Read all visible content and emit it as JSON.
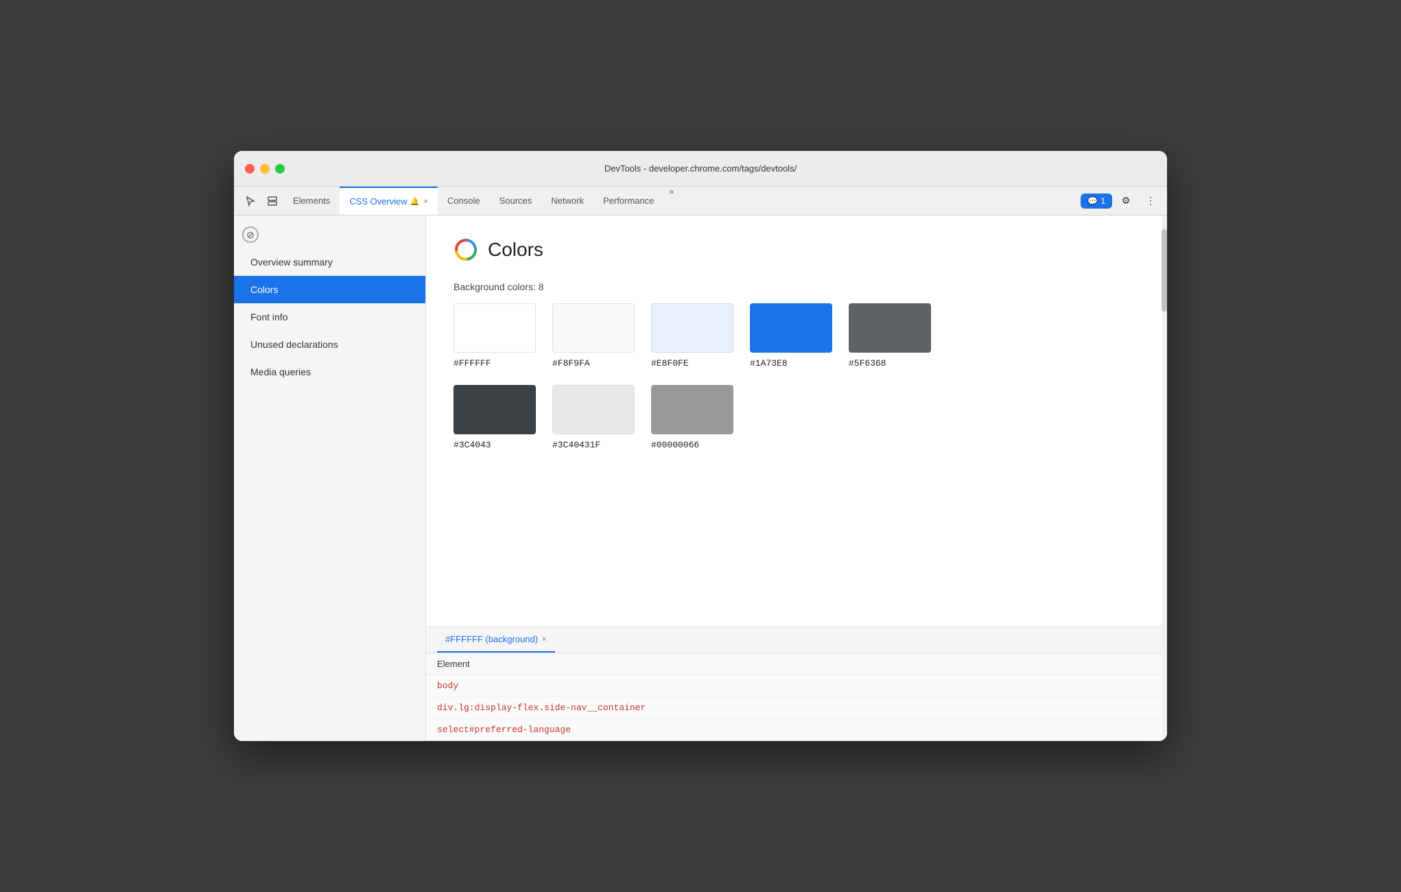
{
  "window": {
    "title": "DevTools - developer.chrome.com/tags/devtools/"
  },
  "titlebar": {
    "traffic_lights": [
      "red",
      "yellow",
      "green"
    ]
  },
  "tabs": [
    {
      "id": "elements",
      "label": "Elements",
      "active": false,
      "closable": false
    },
    {
      "id": "css-overview",
      "label": "CSS Overview",
      "active": true,
      "closable": true,
      "has_bell": true
    },
    {
      "id": "console",
      "label": "Console",
      "active": false,
      "closable": false
    },
    {
      "id": "sources",
      "label": "Sources",
      "active": false,
      "closable": false
    },
    {
      "id": "network",
      "label": "Network",
      "active": false,
      "closable": false
    },
    {
      "id": "performance",
      "label": "Performance",
      "active": false,
      "closable": false
    }
  ],
  "tabs_overflow": "»",
  "chat_btn": {
    "label": "1",
    "icon": "💬"
  },
  "sidebar": {
    "items": [
      {
        "id": "overview-summary",
        "label": "Overview summary",
        "active": false
      },
      {
        "id": "colors",
        "label": "Colors",
        "active": true
      },
      {
        "id": "font-info",
        "label": "Font info",
        "active": false
      },
      {
        "id": "unused-declarations",
        "label": "Unused declarations",
        "active": false
      },
      {
        "id": "media-queries",
        "label": "Media queries",
        "active": false
      }
    ]
  },
  "colors_page": {
    "title": "Colors",
    "bg_colors_label": "Background colors: 8",
    "swatches_row1": [
      {
        "hex": "#FFFFFF",
        "color": "#FFFFFF",
        "border": true
      },
      {
        "hex": "#F8F9FA",
        "color": "#F8F9FA",
        "border": true
      },
      {
        "hex": "#E8F0FE",
        "color": "#E8F0FE",
        "border": false
      },
      {
        "hex": "#1A73E8",
        "color": "#1A73E8",
        "border": false
      },
      {
        "hex": "#5F6368",
        "color": "#5F6368",
        "border": false
      }
    ],
    "swatches_row2": [
      {
        "hex": "#3C4043",
        "color": "#3C4043",
        "border": false
      },
      {
        "hex": "#3C40431F",
        "color": "#e8e8e8",
        "border": true
      },
      {
        "hex": "#00000066",
        "color": "#9a9a9a",
        "border": false
      }
    ]
  },
  "bottom_panel": {
    "active_tab": "#FFFFFF (background)",
    "tab_close": "×",
    "element_header": "Element",
    "elements": [
      "body",
      "div.lg:display-flex.side-nav__container",
      "select#preferred-language"
    ]
  },
  "icons": {
    "cursor": "⬚",
    "layers": "⧉",
    "block": "⊘",
    "gear": "⚙",
    "more": "⋮"
  }
}
